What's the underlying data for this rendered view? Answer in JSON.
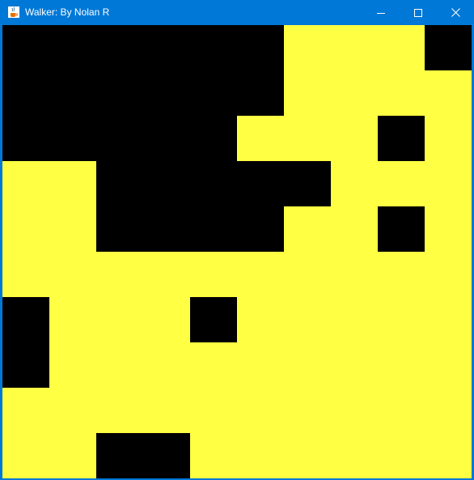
{
  "window": {
    "title": "Walker: By Nolan R",
    "title_bar_color": "#0078d7",
    "app_icon": "java-coffee-cup-icon",
    "controls": [
      "minimize-icon",
      "maximize-icon",
      "close-icon"
    ]
  },
  "grid": {
    "cols": 10,
    "rows": 10,
    "colors": {
      "1": "#000000",
      "0": "#ffff44"
    },
    "cells": [
      [
        1,
        1,
        1,
        1,
        1,
        1,
        0,
        0,
        0,
        1
      ],
      [
        1,
        1,
        1,
        1,
        1,
        1,
        0,
        0,
        0,
        0
      ],
      [
        1,
        1,
        1,
        1,
        1,
        0,
        0,
        0,
        1,
        0
      ],
      [
        0,
        0,
        1,
        1,
        1,
        1,
        1,
        0,
        0,
        0
      ],
      [
        0,
        0,
        1,
        1,
        1,
        1,
        0,
        0,
        1,
        0
      ],
      [
        0,
        0,
        0,
        0,
        0,
        0,
        0,
        0,
        0,
        0
      ],
      [
        1,
        0,
        0,
        0,
        1,
        0,
        0,
        0,
        0,
        0
      ],
      [
        1,
        0,
        0,
        0,
        0,
        0,
        0,
        0,
        0,
        0
      ],
      [
        0,
        0,
        0,
        0,
        0,
        0,
        0,
        0,
        0,
        0
      ],
      [
        0,
        0,
        1,
        1,
        0,
        0,
        0,
        0,
        0,
        0
      ]
    ]
  }
}
